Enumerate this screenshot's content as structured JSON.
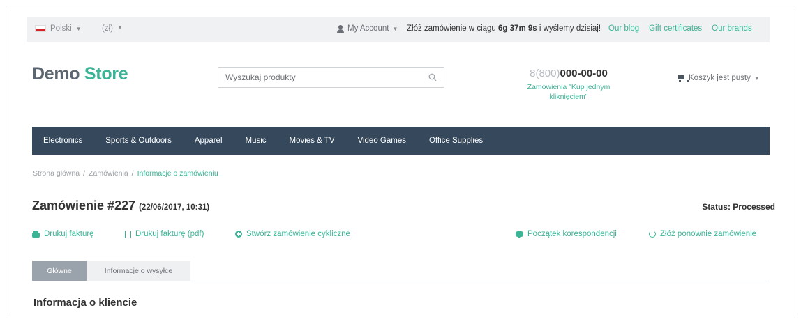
{
  "topbar": {
    "language": "Polski",
    "currency": "(zł)",
    "account": "My Account",
    "promo_prefix": "Złóż zamówienie w ciągu ",
    "promo_time": "6g 37m 9s",
    "promo_suffix": " i wyślemy dzisiaj!",
    "links": [
      "Our blog",
      "Gift certificates",
      "Our brands"
    ]
  },
  "header": {
    "logo_part1": "Demo",
    "logo_part2": "Store",
    "search_placeholder": "Wyszukaj produkty",
    "phone_prefix": "8(800)",
    "phone_main": "000-00-00",
    "one_click_line1": "Zamówienia \"Kup jednym",
    "one_click_line2": "kliknięciem\"",
    "cart": "Koszyk jest pusty"
  },
  "nav": {
    "items": [
      "Electronics",
      "Sports & Outdoors",
      "Apparel",
      "Music",
      "Movies & TV",
      "Video Games",
      "Office Supplies"
    ]
  },
  "breadcrumb": {
    "home": "Strona główna",
    "orders": "Zamówienia",
    "current": "Informacje o zamówieniu",
    "separator": "/"
  },
  "order": {
    "title": "Zamówienie #227",
    "date": "(22/06/2017, 10:31)",
    "status": "Status: Processed"
  },
  "actions": {
    "print_invoice": "Drukuj fakturę",
    "print_invoice_pdf": "Drukuj fakturę (pdf)",
    "create_recurring": "Stwórz zamówienie cykliczne",
    "start_correspondence": "Początek korespondencji",
    "reorder": "Złóż ponownie zamówienie"
  },
  "tabs": {
    "main": "Główne",
    "shipping": "Informacje o wysyłce"
  },
  "section": {
    "customer_info": "Informacja o kliencie"
  }
}
